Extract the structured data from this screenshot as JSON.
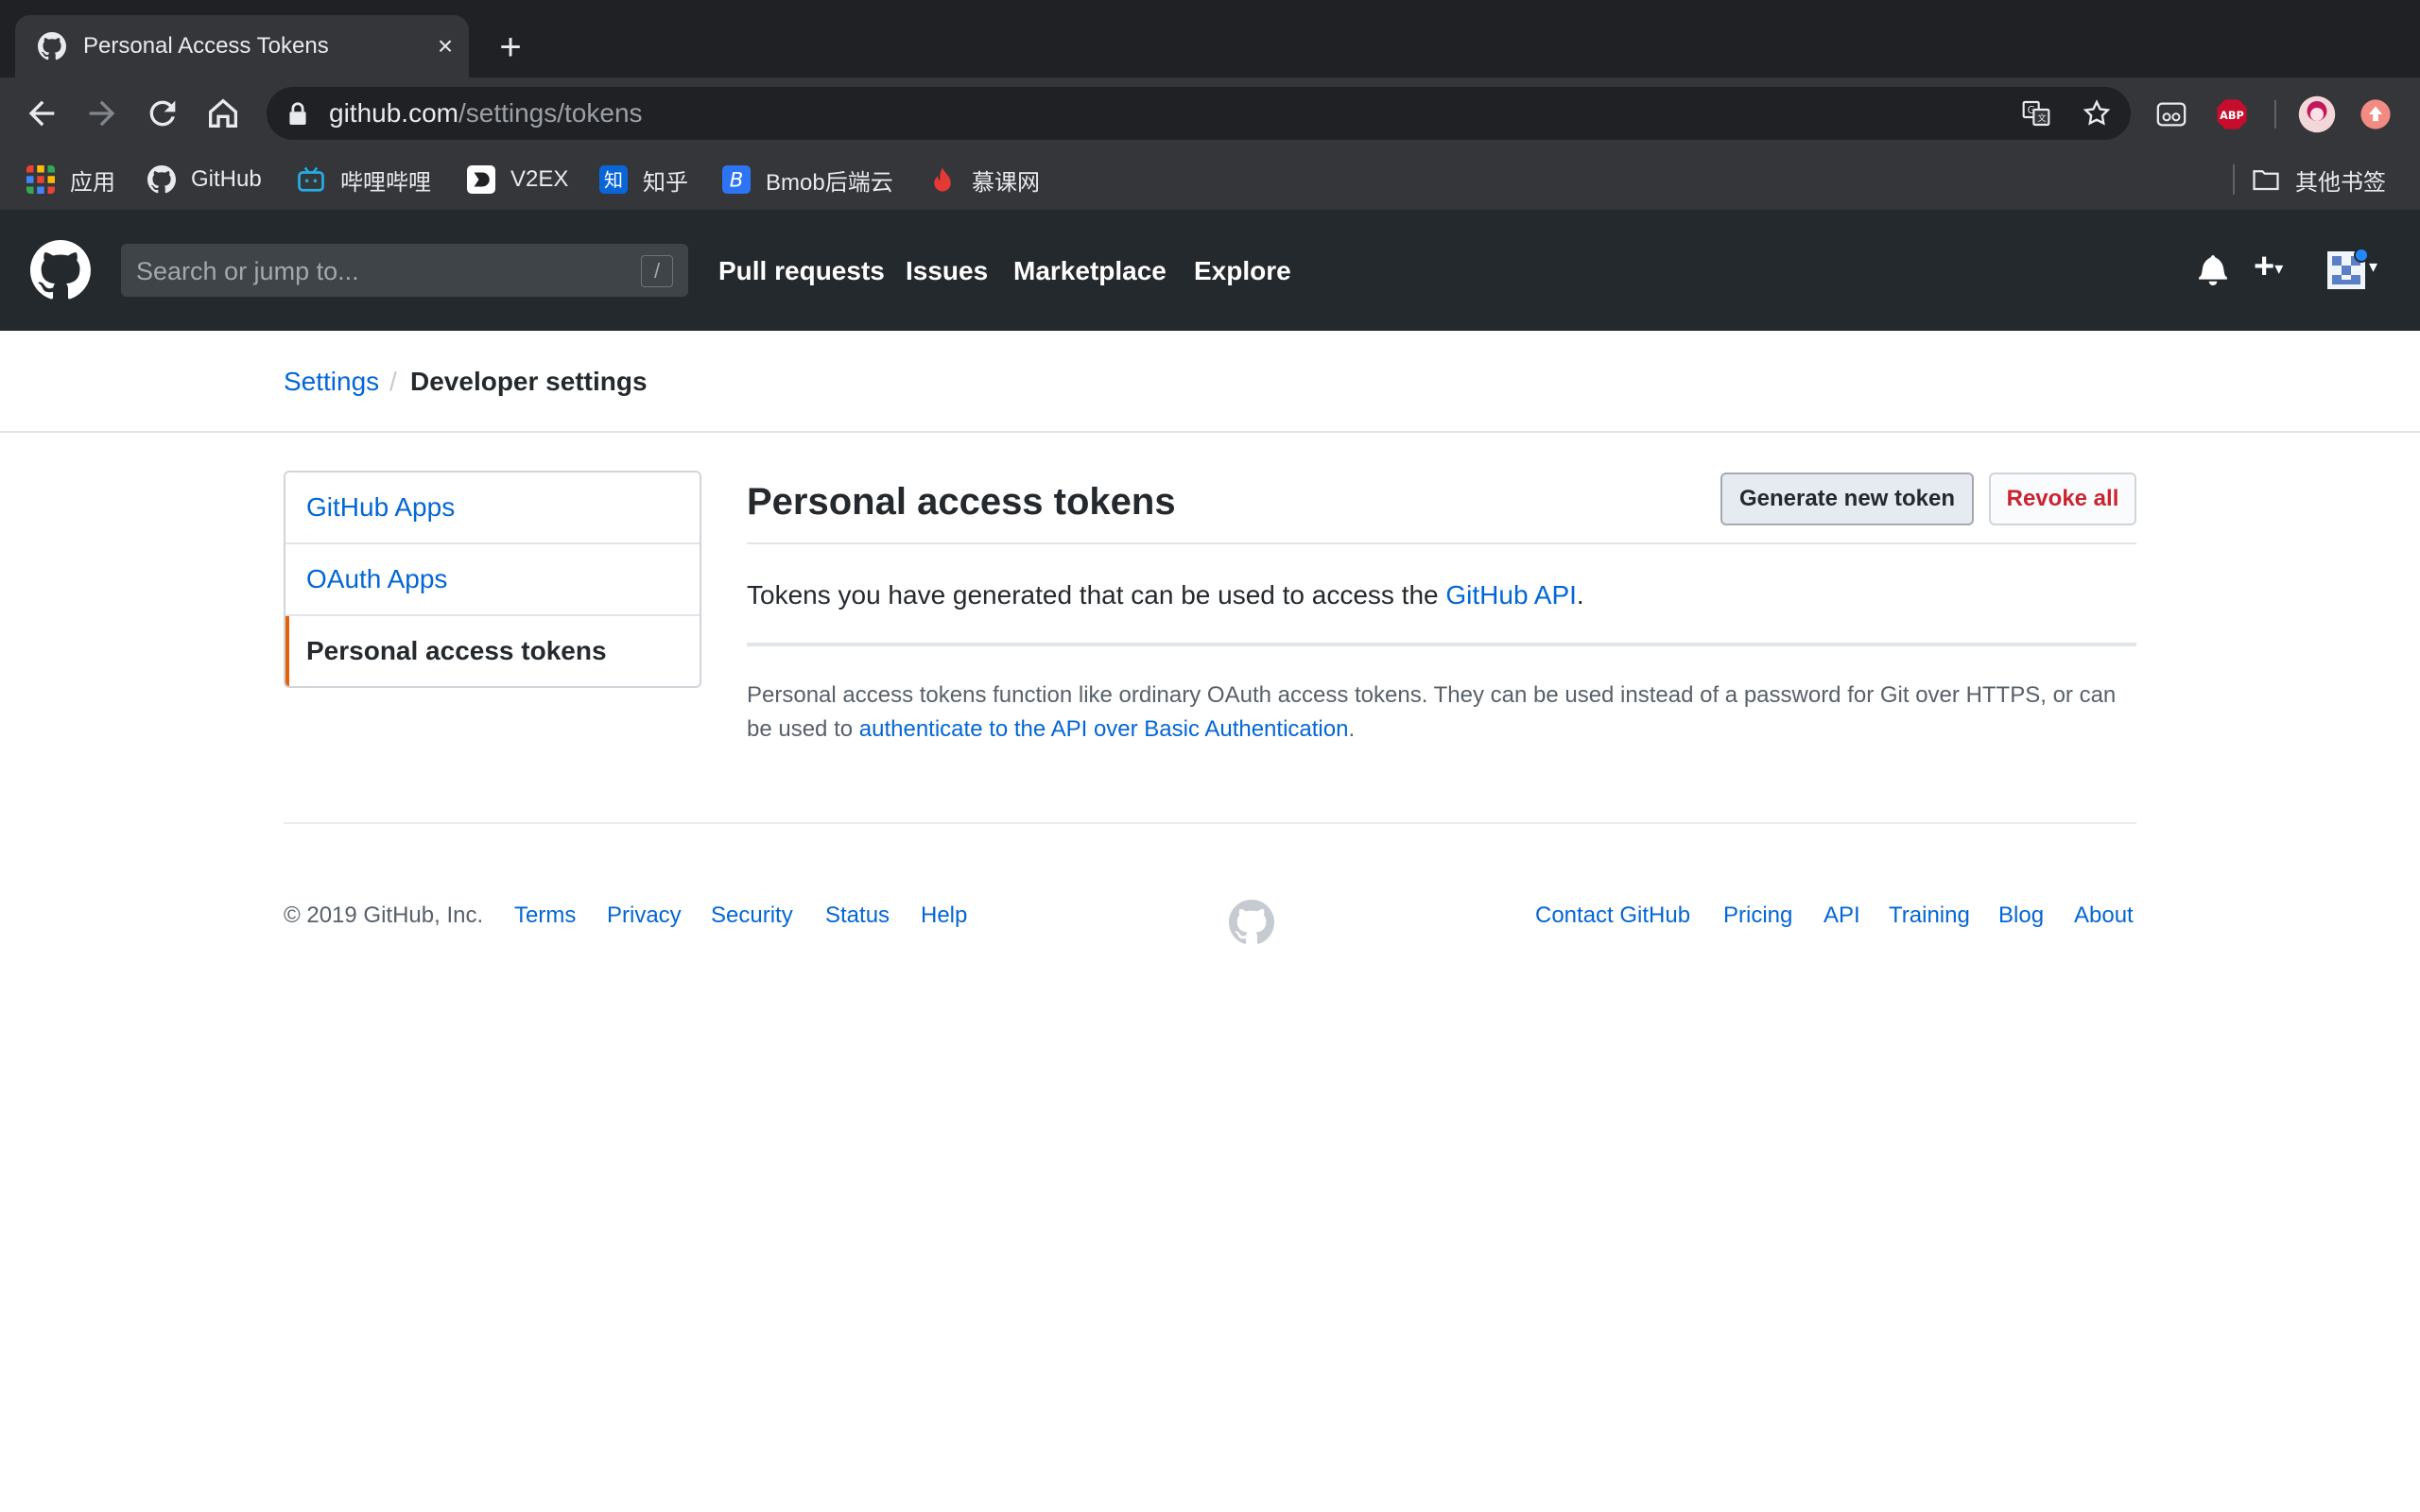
{
  "browser": {
    "tab_title": "Personal Access Tokens",
    "url_host": "github.com",
    "url_path": "/settings/tokens",
    "bookmarks": [
      {
        "label": "应用",
        "icon": "apps-grid-icon"
      },
      {
        "label": "GitHub",
        "icon": "github-icon"
      },
      {
        "label": "哔哩哔哩",
        "icon": "bilibili-icon"
      },
      {
        "label": "V2EX",
        "icon": "v2ex-icon"
      },
      {
        "label": "知乎",
        "icon": "zhihu-icon"
      },
      {
        "label": "Bmob后端云",
        "icon": "bmob-icon"
      },
      {
        "label": "慕课网",
        "icon": "imooc-icon"
      }
    ],
    "other_bookmarks": "其他书签",
    "extensions": [
      "translate-icon",
      "star-icon",
      "reader-icon",
      "adblock-plus-icon",
      "profile-avatar",
      "update-icon"
    ]
  },
  "header": {
    "search_placeholder": "Search or jump to...",
    "search_shortcut": "/",
    "nav": [
      "Pull requests",
      "Issues",
      "Marketplace",
      "Explore"
    ],
    "icons": [
      "bell-icon",
      "plus-icon",
      "avatar"
    ]
  },
  "breadcrumb": {
    "settings": "Settings",
    "separator": "/",
    "current": "Developer settings"
  },
  "sidebar": {
    "items": [
      {
        "label": "GitHub Apps",
        "selected": false
      },
      {
        "label": "OAuth Apps",
        "selected": false
      },
      {
        "label": "Personal access tokens",
        "selected": true
      }
    ]
  },
  "main": {
    "title": "Personal access tokens",
    "generate_button": "Generate new token",
    "revoke_button": "Revoke all",
    "intro_prefix": "Tokens you have generated that can be used to access the ",
    "intro_link": "GitHub API",
    "intro_suffix": ".",
    "note_prefix": "Personal access tokens function like ordinary OAuth access tokens. They can be used instead of a password for Git over HTTPS, or can be used to ",
    "note_link": "authenticate to the API over Basic Authentication",
    "note_suffix": "."
  },
  "footer": {
    "copyright": "© 2019 GitHub, Inc.",
    "left_links": [
      "Terms",
      "Privacy",
      "Security",
      "Status",
      "Help"
    ],
    "right_links": [
      "Contact GitHub",
      "Pricing",
      "API",
      "Training",
      "Blog",
      "About"
    ]
  },
  "colors": {
    "link": "#0366d6",
    "header_bg": "#24292e",
    "selected_accent": "#e36209",
    "danger": "#cb2431"
  }
}
